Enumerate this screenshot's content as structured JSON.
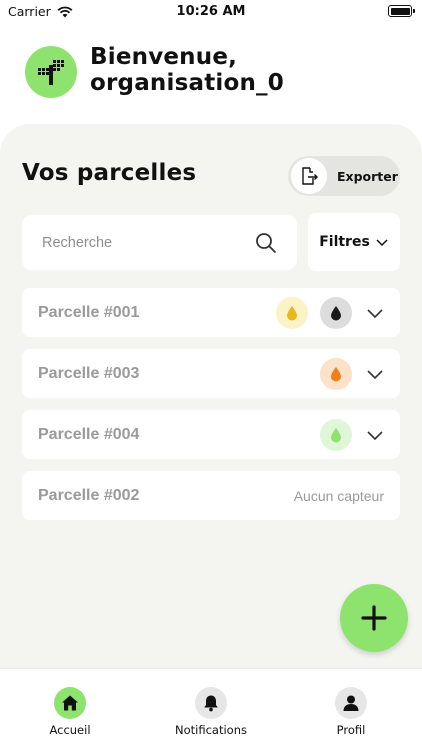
{
  "status_bar": {
    "carrier": "Carrier",
    "time": "10:26 AM"
  },
  "header": {
    "welcome_line1": "Bienvenue,",
    "welcome_line2": "organisation_0"
  },
  "main": {
    "title": "Vos parcelles",
    "export_label": "Exporter",
    "search": {
      "placeholder": "Recherche",
      "value": ""
    },
    "filter_label": "Filtres",
    "parcels": [
      {
        "name": "Parcelle #001",
        "sensors": [
          {
            "icon": "drop-icon",
            "bg": "#fbf3c7",
            "color": "#e8b81c"
          },
          {
            "icon": "drop-icon",
            "bg": "#dcdcdc",
            "color": "#1a1a1a"
          }
        ],
        "expandable": true
      },
      {
        "name": "Parcelle #003",
        "sensors": [
          {
            "icon": "drop-icon",
            "bg": "#fde1c9",
            "color": "#f07f1b"
          }
        ],
        "expandable": true
      },
      {
        "name": "Parcelle #004",
        "sensors": [
          {
            "icon": "drop-icon",
            "bg": "#e0f6d8",
            "color": "#8ee36e"
          }
        ],
        "expandable": true
      },
      {
        "name": "Parcelle #002",
        "no_sensor_label": "Aucun capteur",
        "expandable": false
      }
    ]
  },
  "fab": {
    "icon": "plus-icon"
  },
  "bottom_nav": {
    "items": [
      {
        "label": "Accueil",
        "icon": "home-icon",
        "active": true
      },
      {
        "label": "Notifications",
        "icon": "bell-icon",
        "active": false
      },
      {
        "label": "Profil",
        "icon": "user-icon",
        "active": false
      }
    ]
  },
  "colors": {
    "accent": "#8ee36e",
    "background": "#f4f5f1",
    "muted": "#9a9a9a"
  }
}
